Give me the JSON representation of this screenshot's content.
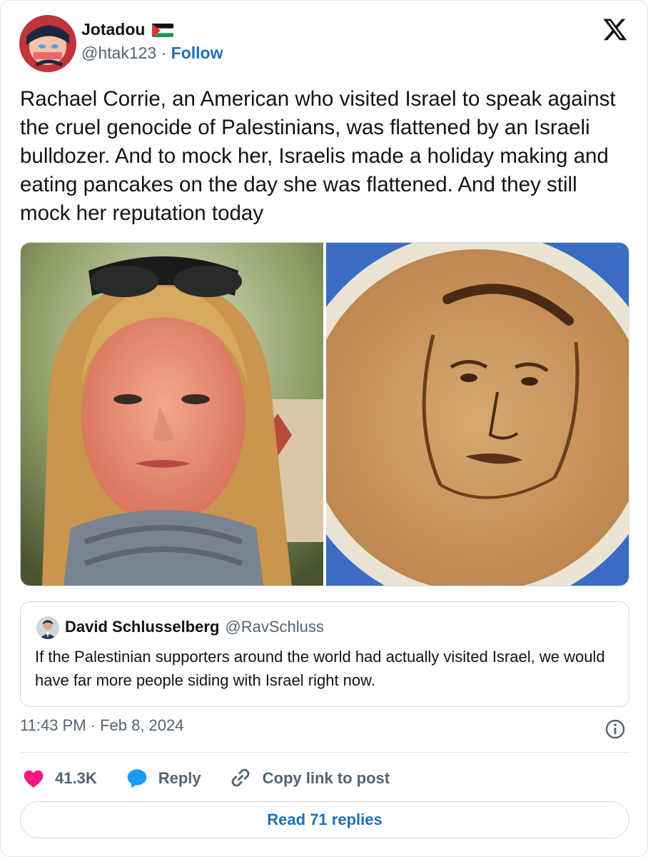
{
  "author": {
    "display_name": "Jotadou",
    "flag_icon": "palestine-flag-icon",
    "handle": "@htak123",
    "separator": "·",
    "follow_label": "Follow"
  },
  "brand_icon": "x-logo-icon",
  "tweet_text": "Rachael Corrie, an American who visited Israel to speak against the cruel genocide of Palestinians, was flattened by an Israeli bulldozer. And to mock her, Israelis made a holiday making and eating pancakes on the day she was flattened. And they still mock her reputation today",
  "media": [
    {
      "icon": "photo-woman-portrait"
    },
    {
      "icon": "photo-pancake-face"
    }
  ],
  "quote": {
    "display_name": "David Schlusselberg",
    "handle": "@RavSchluss",
    "text": "If the Palestinian supporters around the world had actually visited Israel, we would have far more people siding with Israel right now."
  },
  "timestamp": "11:43 PM · Feb 8, 2024",
  "actions": {
    "like_count": "41.3K",
    "reply_label": "Reply",
    "copy_link_label": "Copy link to post"
  },
  "read_replies_label": "Read 71 replies",
  "colors": {
    "link": "#1d70b8",
    "like": "#f91880",
    "reply_icon": "#1d9bf0",
    "muted": "#536471"
  }
}
